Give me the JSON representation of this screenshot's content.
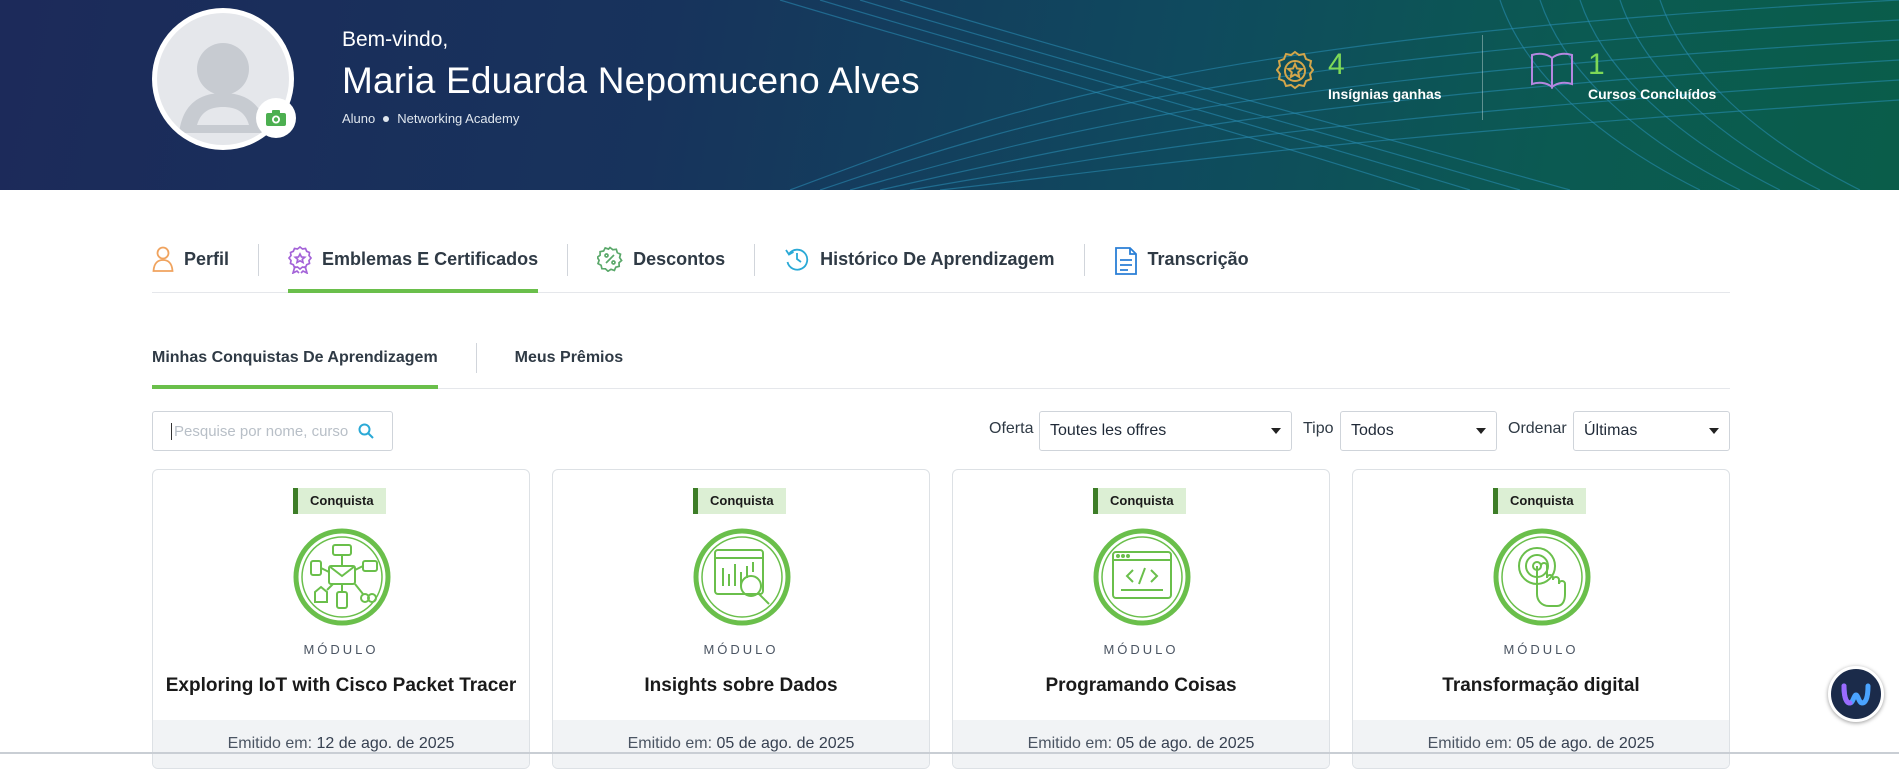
{
  "banner": {
    "welcome": "Bem-vindo,",
    "user_name": "Maria Eduarda Nepomuceno Alves",
    "role": "Aluno",
    "organization": "Networking Academy",
    "stats": [
      {
        "value": "4",
        "label": "Insígnias ganhas",
        "icon": "medal-icon"
      },
      {
        "value": "1",
        "label": "Cursos Concluídos",
        "icon": "open-book-icon"
      }
    ]
  },
  "main_tabs": [
    {
      "label": "Perfil",
      "icon": "user-icon",
      "active": false
    },
    {
      "label": "Emblemas E Certificados",
      "icon": "award-icon",
      "active": true
    },
    {
      "label": "Descontos",
      "icon": "discount-icon",
      "active": false
    },
    {
      "label": "Histórico De Aprendizagem",
      "icon": "history-icon",
      "active": false
    },
    {
      "label": "Transcrição",
      "icon": "document-icon",
      "active": false
    }
  ],
  "sub_tabs": [
    {
      "label": "Minhas Conquistas De Aprendizagem",
      "active": true
    },
    {
      "label": "Meus Prêmios",
      "active": false
    }
  ],
  "filters": {
    "search_placeholder": "Pesquise por nome, curso",
    "offer_label": "Oferta",
    "offer_value": "Toutes les offres",
    "type_label": "Tipo",
    "type_value": "Todos",
    "sort_label": "Ordenar",
    "sort_value": "Últimas"
  },
  "cards": [
    {
      "tag": "Conquista",
      "kind": "MÓDULO",
      "title": "Exploring IoT with Cisco Packet Tracer",
      "issued_label": "Emitido em:",
      "issued_date": "12 de ago. de 2025",
      "icon": "iot-devices-icon"
    },
    {
      "tag": "Conquista",
      "kind": "MÓDULO",
      "title": "Insights sobre Dados",
      "issued_label": "Emitido em:",
      "issued_date": "05 de ago. de 2025",
      "icon": "data-magnifier-icon"
    },
    {
      "tag": "Conquista",
      "kind": "MÓDULO",
      "title": "Programando Coisas",
      "issued_label": "Emitido em:",
      "issued_date": "05 de ago. de 2025",
      "icon": "code-window-icon"
    },
    {
      "tag": "Conquista",
      "kind": "MÓDULO",
      "title": "Transformação digital",
      "issued_label": "Emitido em:",
      "issued_date": "05 de ago. de 2025",
      "icon": "touch-target-icon"
    }
  ],
  "colors": {
    "accent_green": "#6abf4b",
    "stat_green": "#7ed957",
    "banner_navy": "#1c2a5a",
    "banner_teal": "#0a5d4a"
  }
}
